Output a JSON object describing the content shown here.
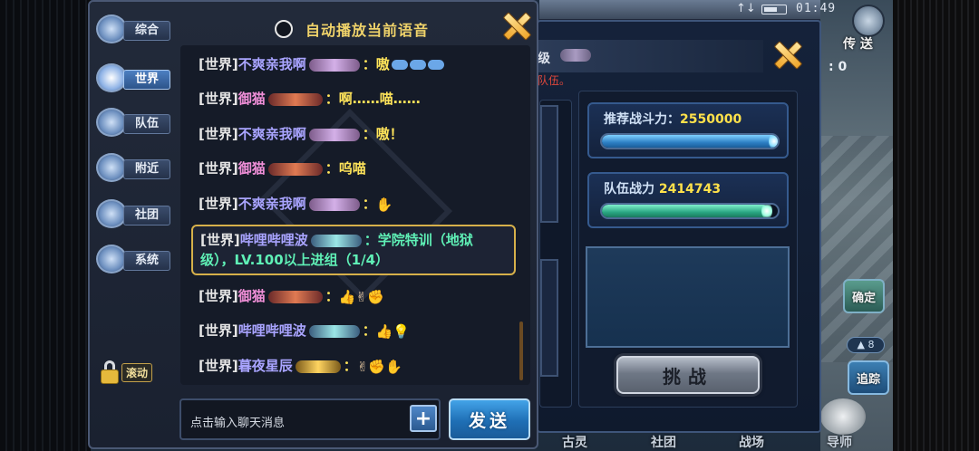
{
  "status": {
    "time": "01:49",
    "signal": "↑↓"
  },
  "scene": {
    "teleport_label": "传 送",
    "colon_zero": ": 0",
    "confirm_label": "确定",
    "track_label": "追踪",
    "small_badge": "▲ 8",
    "bottom_nav": [
      "古灵",
      "社团",
      "战场",
      "导师"
    ]
  },
  "chat": {
    "header": "自动播放当前语音",
    "tabs": [
      {
        "label": "综合",
        "icon": "speech-bubbles-icon"
      },
      {
        "label": "世界",
        "icon": "speaker-icon"
      },
      {
        "label": "队伍",
        "icon": "team-shield-icon"
      },
      {
        "label": "附近",
        "icon": "location-pin-icon"
      },
      {
        "label": "社团",
        "icon": "guild-flag-icon"
      },
      {
        "label": "系统",
        "icon": "system-gear-icon"
      }
    ],
    "active_tab": "世界",
    "scroll_lock_label": "滚动",
    "messages": [
      {
        "channel": "[世界]",
        "name": "不爽亲我啊",
        "text": "：嗷",
        "emoji": ""
      },
      {
        "channel": "[世界]",
        "name": "御猫",
        "text": "：啊……喵……",
        "emoji": ""
      },
      {
        "channel": "[世界]",
        "name": "不爽亲我啊",
        "text": "：嗷！",
        "emoji": ""
      },
      {
        "channel": "[世界]",
        "name": "御猫",
        "text": "：呜喵",
        "emoji": ""
      },
      {
        "channel": "[世界]",
        "name": "不爽亲我啊",
        "text": "：",
        "emoji": "✋"
      },
      {
        "channel": "[世界]",
        "name": "哔哩哔哩波",
        "text": "：学院特训（地狱级），LV.100以上进组（1/4）",
        "emoji": ""
      },
      {
        "channel": "[世界]",
        "name": "御猫",
        "text": "：",
        "emoji": "👍✌✊"
      },
      {
        "channel": "[世界]",
        "name": "哔哩哔哩波",
        "text": "：",
        "emoji": "👍💡"
      },
      {
        "channel": "[世界]",
        "name": "暮夜星辰",
        "text": "：",
        "emoji": "✌✊✋"
      }
    ],
    "input_placeholder": "点击输入聊天消息",
    "plus_label": "+",
    "send_label": "发送"
  },
  "team": {
    "title_char": "级",
    "warning": "队伍。",
    "recommended_label": "推荐战斗力：",
    "recommended_value": "2550000",
    "team_label": "队伍战力 ",
    "team_value": "2414743",
    "team_fill_ratio": 0.947,
    "challenge_label": "挑战"
  },
  "colors": {
    "accent_gold": "#f0d36a",
    "name_purple": "#a9a4ff",
    "name_pink": "#f08fd8",
    "text_yellow": "#ffe45a",
    "text_cyan": "#5ff0b6",
    "send_blue": "#1f6fb5"
  }
}
